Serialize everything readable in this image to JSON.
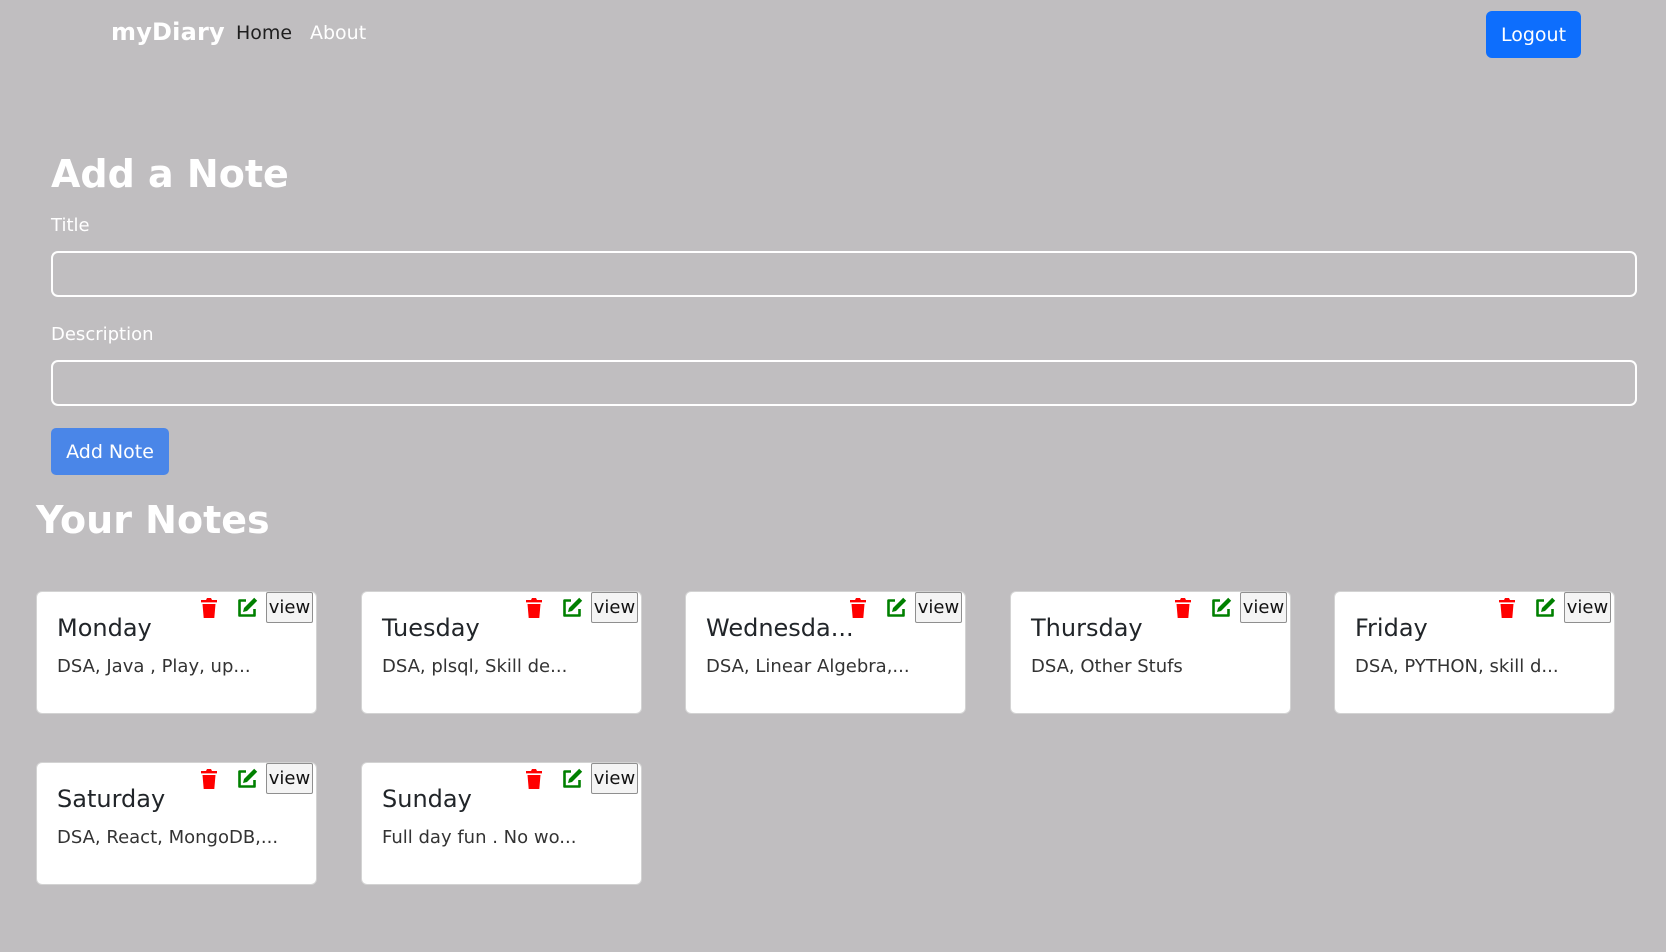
{
  "navbar": {
    "brand": "myDiary",
    "links": [
      {
        "label": "Home"
      },
      {
        "label": "About"
      }
    ],
    "logout_label": "Logout",
    "accent_color": "#0d6efd"
  },
  "form": {
    "heading": "Add a Note",
    "title_label": "Title",
    "title_value": "",
    "description_label": "Description",
    "description_value": "",
    "submit_label": "Add Note"
  },
  "notes_section": {
    "heading": "Your Notes",
    "view_label": "view",
    "notes": [
      {
        "title": "Monday",
        "description": "DSA, Java , Play, up..."
      },
      {
        "title": "Tuesday",
        "description": "DSA, plsql, Skill de..."
      },
      {
        "title": "Wednesda...",
        "description": "DSA, Linear Algebra,..."
      },
      {
        "title": "Thursday",
        "description": "DSA, Other Stufs"
      },
      {
        "title": "Friday",
        "description": "DSA, PYTHON, skill d..."
      },
      {
        "title": "Saturday",
        "description": "DSA, React, MongoDB,..."
      },
      {
        "title": "Sunday",
        "description": "Full day fun . No wo..."
      }
    ]
  },
  "icons": {
    "delete": "trash-icon",
    "edit": "edit-icon",
    "delete_color": "#ff0000",
    "edit_color": "#008000"
  }
}
